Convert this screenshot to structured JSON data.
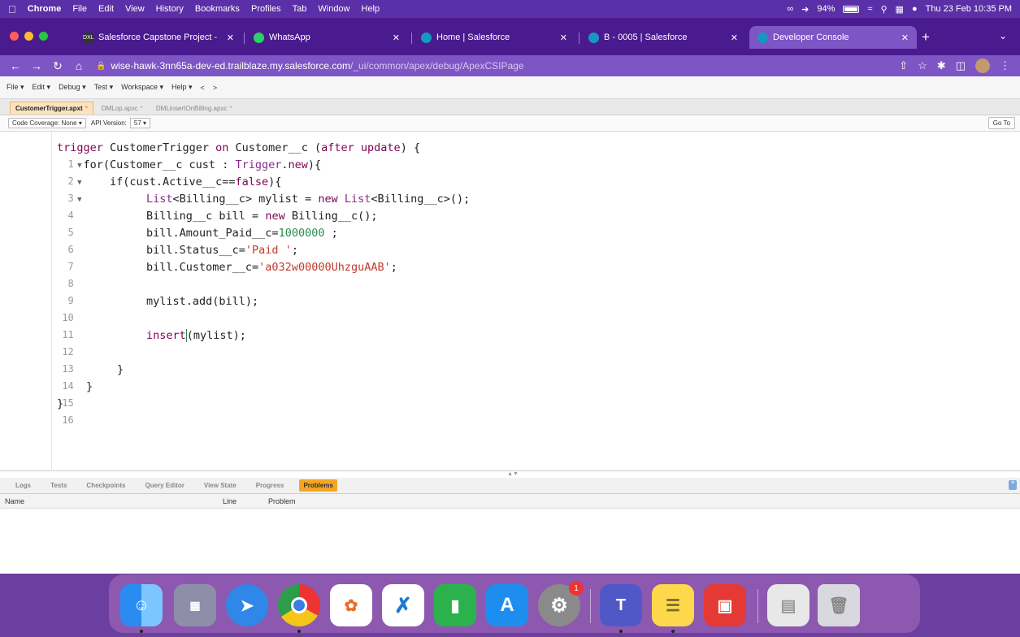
{
  "menubar": {
    "app": "Chrome",
    "items": [
      "File",
      "Edit",
      "View",
      "History",
      "Bookmarks",
      "Profiles",
      "Tab",
      "Window",
      "Help"
    ],
    "battery": "94%",
    "datetime": "Thu 23 Feb 10:35 PM"
  },
  "tabs": [
    {
      "label": "Salesforce Capstone Project -",
      "favicon": "DXL"
    },
    {
      "label": "WhatsApp",
      "favicon": ""
    },
    {
      "label": "Home | Salesforce",
      "favicon": ""
    },
    {
      "label": "B - 0005 | Salesforce",
      "favicon": ""
    },
    {
      "label": "Developer Console",
      "favicon": ""
    }
  ],
  "address": {
    "host": "wise-hawk-3nn65a-dev-ed.trailblaze.my.salesforce.com",
    "path": "/_ui/common/apex/debug/ApexCSIPage"
  },
  "devmenu": [
    "File ▾",
    "Edit ▾",
    "Debug ▾",
    "Test ▾",
    "Workspace ▾",
    "Help ▾",
    "<",
    ">"
  ],
  "filetabs": [
    "CustomerTrigger.apxt",
    "DMLop.apxc",
    "DMLinsertOnBilling.apxc"
  ],
  "codebar": {
    "coverage": "Code Coverage: None",
    "api_label": "API Version:",
    "api_value": "57",
    "goto": "Go To"
  },
  "line_numbers": [
    "1",
    "2",
    "3",
    "4",
    "5",
    "6",
    "7",
    "8",
    "9",
    "10",
    "11",
    "12",
    "13",
    "14",
    "15",
    "16"
  ],
  "code": {
    "l1": {
      "kw": "trigger",
      "a": " CustomerTrigger ",
      "kw2": "on",
      "b": " Customer__c (",
      "kw3": "after update",
      "c": ") {"
    },
    "l2": {
      "a": "    for(Customer__c cust : ",
      "ty": "Trigger",
      "b": ".",
      "kw": "new",
      "c": "){"
    },
    "l3": {
      "a": "        if(cust.Active__c==",
      "kw": "false",
      "b": "){"
    },
    "l4": {
      "ty": "List",
      "a": "<Billing__c> mylist = ",
      "kw": "new",
      "b": " ",
      "ty2": "List",
      "c": "<Billing__c>();"
    },
    "l5": {
      "a": "Billing__c bill = ",
      "kw": "new",
      "b": " Billing__c();"
    },
    "l6": {
      "a": "bill.Amount_Paid__c=",
      "num": "1000000",
      "b": " ;"
    },
    "l7": {
      "a": "bill.Status__c=",
      "str": "'Paid '",
      "b": ";"
    },
    "l8": {
      "a": "bill.Customer__c=",
      "str": "'a032w00000UhzguAAB'",
      "b": ";"
    },
    "l10": "mylist.add(bill);",
    "l12": {
      "kw": "insert",
      "a": "(mylist);"
    },
    "l14": "}",
    "l15": "}",
    "l16": "}"
  },
  "bottomtabs": [
    "Logs",
    "Tests",
    "Checkpoints",
    "Query Editor",
    "View State",
    "Progress",
    "Problems"
  ],
  "problems_columns": [
    "Name",
    "Line",
    "Problem"
  ],
  "dock": {
    "apps": [
      "finder-icon",
      "launchpad-icon",
      "safari-icon",
      "chrome-icon",
      "photos-icon",
      "vscode-icon",
      "numbers-icon",
      "appstore-icon",
      "settings-icon",
      "teams-icon",
      "notes-icon",
      "photobooth-icon",
      "document-icon",
      "trash-icon"
    ],
    "settings_badge": "1"
  }
}
